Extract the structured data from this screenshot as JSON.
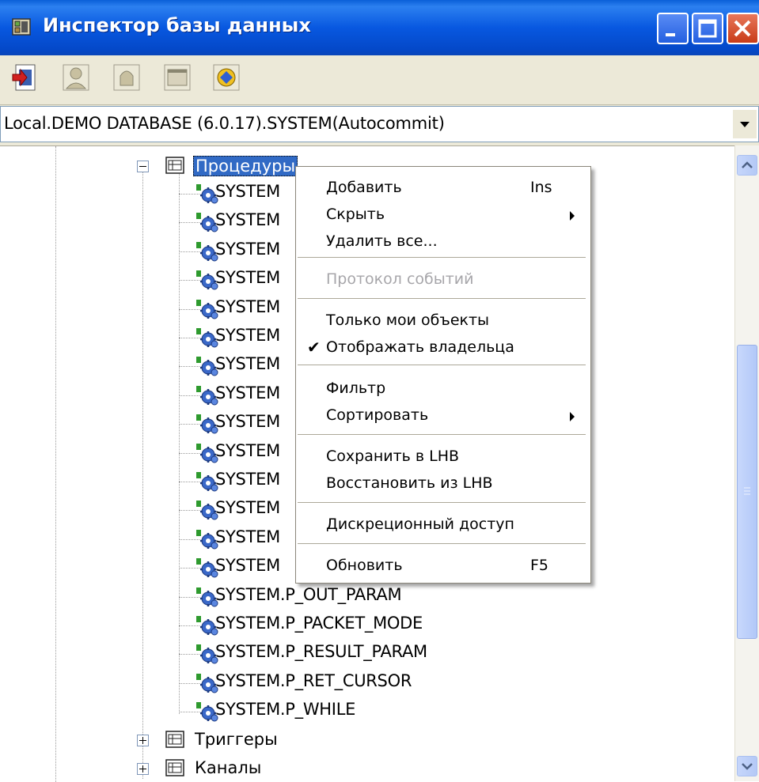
{
  "window": {
    "title": "Инспектор базы данных"
  },
  "toolbar": {
    "buttons": [
      {
        "name": "add-object-icon"
      },
      {
        "name": "user-icon"
      },
      {
        "name": "bell-icon"
      },
      {
        "name": "panel-icon"
      },
      {
        "name": "refresh-connection-icon"
      }
    ]
  },
  "connection": {
    "value": "Local.DEMO DATABASE (6.0.17).SYSTEM(Autocommit)"
  },
  "tree": {
    "procedures_label": "Процедуры",
    "procedure_items": [
      "SYSTEM",
      "SYSTEM",
      "SYSTEM",
      "SYSTEM",
      "SYSTEM",
      "SYSTEM",
      "SYSTEM",
      "SYSTEM",
      "SYSTEM",
      "SYSTEM",
      "SYSTEM",
      "SYSTEM",
      "SYSTEM",
      "SYSTEM",
      "SYSTEM.P_OUT_PARAM",
      "SYSTEM.P_PACKET_MODE",
      "SYSTEM.P_RESULT_PARAM",
      "SYSTEM.P_RET_CURSOR",
      "SYSTEM.P_WHILE"
    ],
    "triggers_label": "Триггеры",
    "channels_label": "Каналы"
  },
  "context_menu": {
    "items": [
      {
        "label": "Добавить",
        "shortcut": "Ins"
      },
      {
        "label": "Скрыть"
      },
      {
        "label": "Удалить все..."
      },
      {
        "label": "Протокол событий"
      },
      {
        "label": "Только мои объекты"
      },
      {
        "label": "Отображать владельца",
        "checked": true
      },
      {
        "label": "Фильтр"
      },
      {
        "label": "Сортировать"
      },
      {
        "label": "Сохранить в LHB"
      },
      {
        "label": "Восстановить из LHB"
      },
      {
        "label": "Дискреционный доступ"
      },
      {
        "label": "Обновить",
        "shortcut": "F5"
      }
    ]
  },
  "colors": {
    "titlebar": "#0858e0",
    "selection": "#316ac5",
    "disabled_text": "#a7a6aa"
  }
}
